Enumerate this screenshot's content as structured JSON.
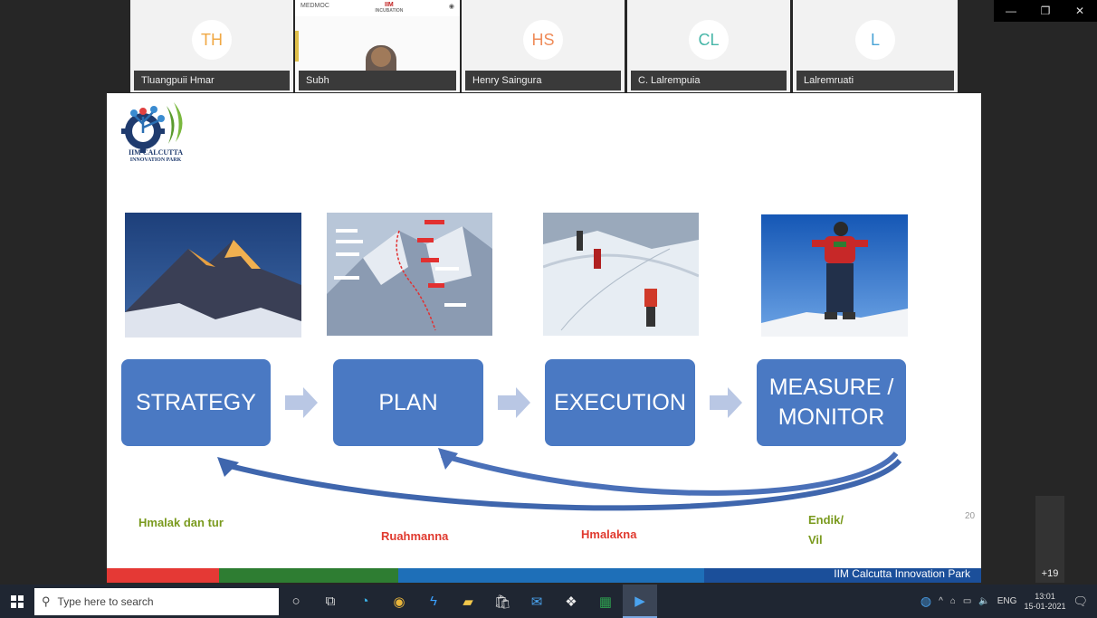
{
  "window": {
    "minimize": "—",
    "restore": "❐",
    "close": "✕"
  },
  "participants": [
    {
      "initials": "TH",
      "name": "Tluangpuii Hmar",
      "color": "#f0a844"
    },
    {
      "name": "Subh",
      "video": true,
      "brand_left": "MEDMOC",
      "brand_mid": "IIM",
      "brand_sub": "INCUBATION"
    },
    {
      "initials": "HS",
      "name": "Henry Saingura",
      "color": "#ef8c5a"
    },
    {
      "initials": "CL",
      "name": "C. Lalrempuia",
      "color": "#47b6a8"
    },
    {
      "initials": "L",
      "name": "Lalremruati",
      "color": "#4aa3d6"
    }
  ],
  "slide": {
    "logo_line1": "IIM CALCUTTA",
    "logo_line2": "INNOVATION PARK",
    "steps": [
      "STRATEGY",
      "PLAN",
      "EXECUTION",
      "MEASURE / MONITOR"
    ],
    "labels": {
      "strategy": "Hmalak dan tur",
      "plan": "Ruahmanna",
      "execution": "Hmalakna",
      "measure_line1": "Endik/",
      "measure_line2": "Vil"
    },
    "label_colors": {
      "green": "#7a9a1e",
      "red": "#e03a2f"
    },
    "page_number": "20",
    "footer": "IIM Calcutta Innovation Park",
    "band_colors": [
      "#e53935",
      "#2e7d32",
      "#1e6fb8",
      "#1b4f9a"
    ]
  },
  "more_participants": "+19",
  "taskbar": {
    "search_placeholder": "Type here to search",
    "lang": "ENG",
    "time": "13:01",
    "date": "15-01-2021"
  }
}
